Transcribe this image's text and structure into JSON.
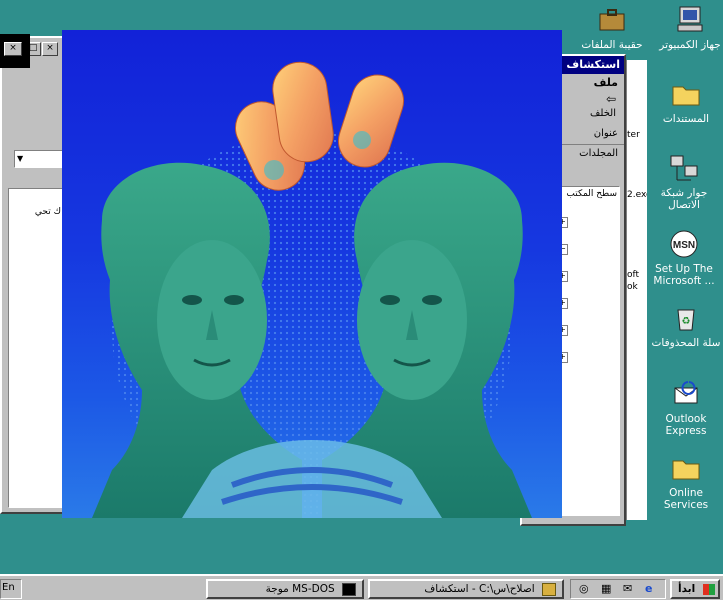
{
  "desktop_icons": [
    {
      "label": "جهاز الكمبيوتر",
      "icon": "computer-icon"
    },
    {
      "label": "حقيبة الملفات",
      "icon": "briefcase-icon"
    },
    {
      "label": "المستندات",
      "icon": "folder-icon"
    },
    {
      "label": "جوار شبكة الاتصال",
      "icon": "network-icon"
    },
    {
      "label": "Set Up The Microsoft ...",
      "icon": "msn-icon"
    },
    {
      "label": "سلة المحذوفات",
      "icon": "recycle-bin-icon"
    },
    {
      "label": "Outlook Express",
      "icon": "outlook-express-icon"
    },
    {
      "label": "Online Services",
      "icon": "folder-icon"
    }
  ],
  "explorer_window": {
    "title": "استكشاف",
    "menu": [
      "ملف"
    ],
    "toolbar": {
      "back": "الخلف"
    },
    "address_label": "عنوان",
    "folders_header": "المجلدات",
    "tree_root": "سطح المكتب",
    "partial_right": [
      "ter",
      "2.exe",
      "oft",
      "ok"
    ]
  },
  "left_window": {
    "partial_text": "ك تحي"
  },
  "taskbar": {
    "start_label": "ابدأ",
    "buttons": [
      {
        "label": "استكشاف - C:\\اصلاح\\س",
        "icon": "explorer-icon"
      },
      {
        "label": "موجة MS-DOS",
        "icon": "msdos-icon"
      }
    ],
    "tray_label": "En"
  },
  "colors": {
    "desktop": "#2f8f8c",
    "titlebar": "#000080",
    "face": "#c0c0c0"
  }
}
